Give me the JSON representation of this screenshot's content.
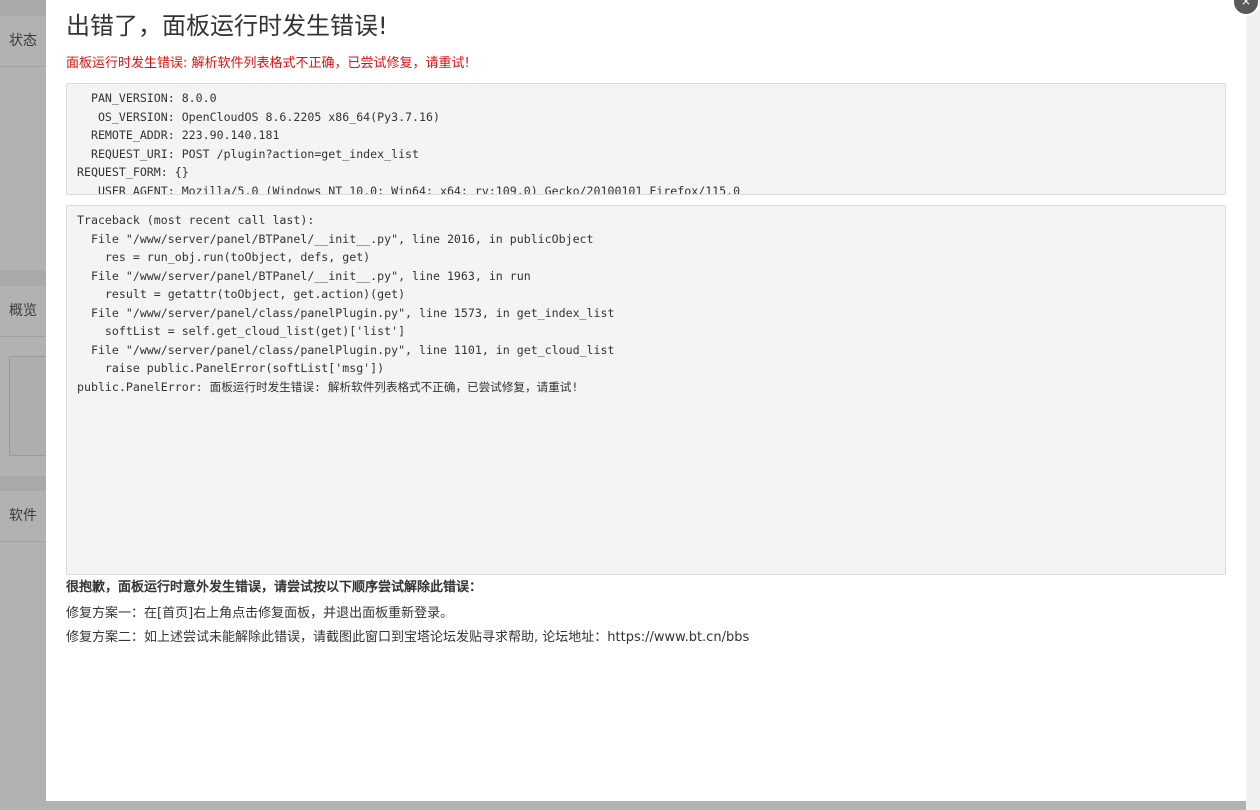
{
  "modal": {
    "title": "出错了，面板运行时发生错误!",
    "message": "面板运行时发生错误: 解析软件列表格式不正确，已尝试修复，请重试!",
    "env_lines": [
      "  PAN_VERSION: 8.0.0",
      "   OS_VERSION: OpenCloudOS 8.6.2205 x86_64(Py3.7.16)",
      "  REMOTE_ADDR: 223.90.140.181",
      "  REQUEST_URI: POST /plugin?action=get_index_list",
      "REQUEST_FORM: {}",
      "   USER_AGENT: Mozilla/5.0 (Windows NT 10.0; Win64; x64; rv:109.0) Gecko/20100101 Firefox/115.0"
    ],
    "traceback_lines": [
      "Traceback (most recent call last):",
      "  File \"/www/server/panel/BTPanel/__init__.py\", line 2016, in publicObject",
      "    res = run_obj.run(toObject, defs, get)",
      "  File \"/www/server/panel/BTPanel/__init__.py\", line 1963, in run",
      "    result = getattr(toObject, get.action)(get)",
      "  File \"/www/server/panel/class/panelPlugin.py\", line 1573, in get_index_list",
      "    softList = self.get_cloud_list(get)['list']",
      "  File \"/www/server/panel/class/panelPlugin.py\", line 1101, in get_cloud_list",
      "    raise public.PanelError(softList['msg'])",
      "public.PanelError: 面板运行时发生错误: 解析软件列表格式不正确，已尝试修复，请重试!"
    ],
    "help_heading": "很抱歉，面板运行时意外发生错误，请尝试按以下顺序尝试解除此错误：",
    "fix1": "修复方案一：在[首页]右上角点击修复面板，并退出面板重新登录。",
    "fix2": "修复方案二：如上述尝试未能解除此错误，请截图此窗口到宝塔论坛发贴寻求帮助, 论坛地址：https://www.bt.cn/bbs",
    "close_icon": "×"
  },
  "background": {
    "section_status": "状态",
    "section_overview": "概览",
    "section_software": "软件"
  }
}
